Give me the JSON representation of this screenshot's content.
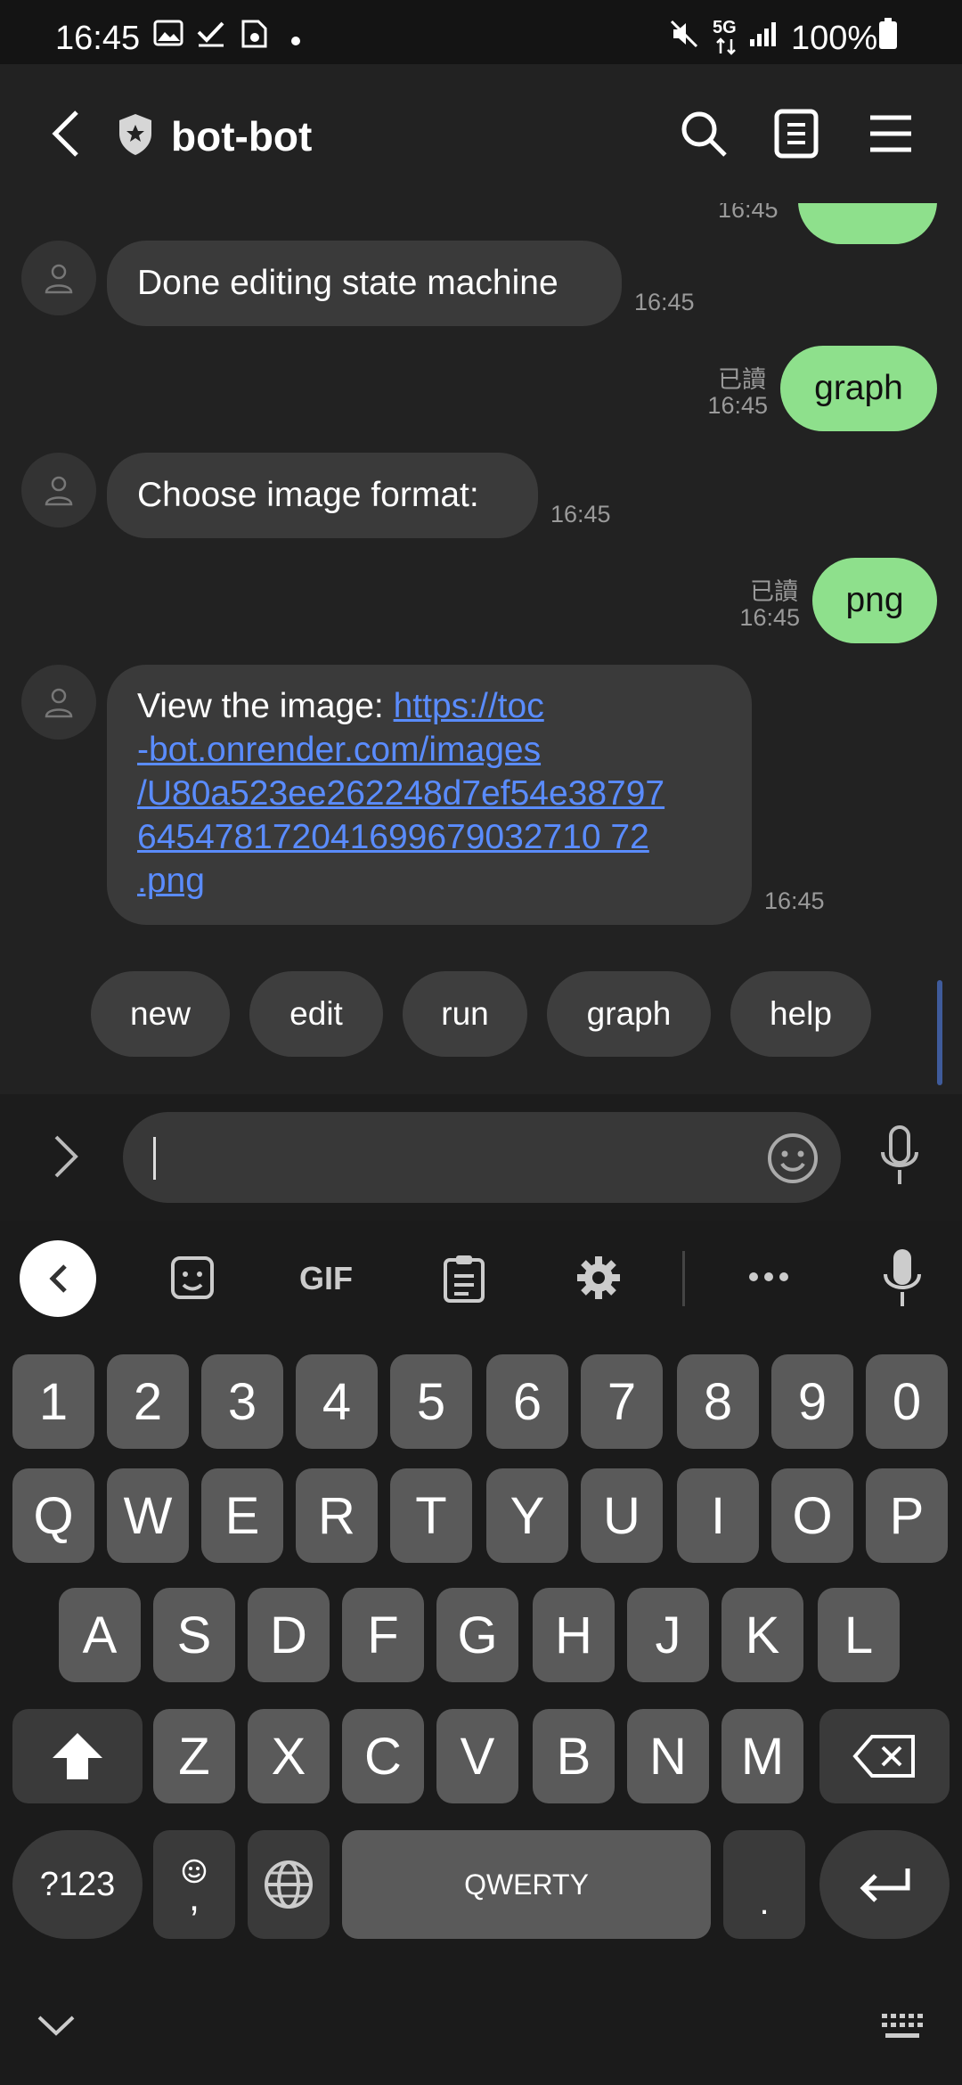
{
  "status_bar": {
    "time": "16:45",
    "network": "5G",
    "battery": "100%"
  },
  "header": {
    "title": "bot-bot"
  },
  "messages": {
    "m1": {
      "text": "Done editing state machine",
      "time": "16:45"
    },
    "m2": {
      "text": "graph",
      "read": "已讀",
      "time": "16:45"
    },
    "m3": {
      "text": "Choose image format:",
      "time": "16:45"
    },
    "m4": {
      "text": "png",
      "read": "已讀",
      "time": "16:45"
    },
    "m5": {
      "prefix": "View the image: ",
      "link_lines": [
        "https://toc",
        "-bot.onrender.com/images",
        "/U80a523ee262248d7ef54e38797",
        "645478172041699679032710 72",
        ".png"
      ],
      "time": "16:45"
    },
    "partial_time": "16:45"
  },
  "quick_replies": [
    "new",
    "edit",
    "run",
    "graph",
    "help"
  ],
  "input": {
    "value": ""
  },
  "keyboard_toolbar": {
    "gif_label": "GIF"
  },
  "keyboard": {
    "row_numbers": [
      "1",
      "2",
      "3",
      "4",
      "5",
      "6",
      "7",
      "8",
      "9",
      "0"
    ],
    "row1": [
      "Q",
      "W",
      "E",
      "R",
      "T",
      "Y",
      "U",
      "I",
      "O",
      "P"
    ],
    "row2": [
      "A",
      "S",
      "D",
      "F",
      "G",
      "H",
      "J",
      "K",
      "L"
    ],
    "row3": [
      "Z",
      "X",
      "C",
      "V",
      "B",
      "N",
      "M"
    ],
    "symbols_label": "?123",
    "comma_label": ",",
    "space_label": "QWERTY",
    "period_label": "."
  },
  "colors": {
    "background": "#222222",
    "outgoing_bubble": "#8ee08c",
    "incoming_bubble": "#3a3a3a",
    "link": "#5a8cff"
  }
}
